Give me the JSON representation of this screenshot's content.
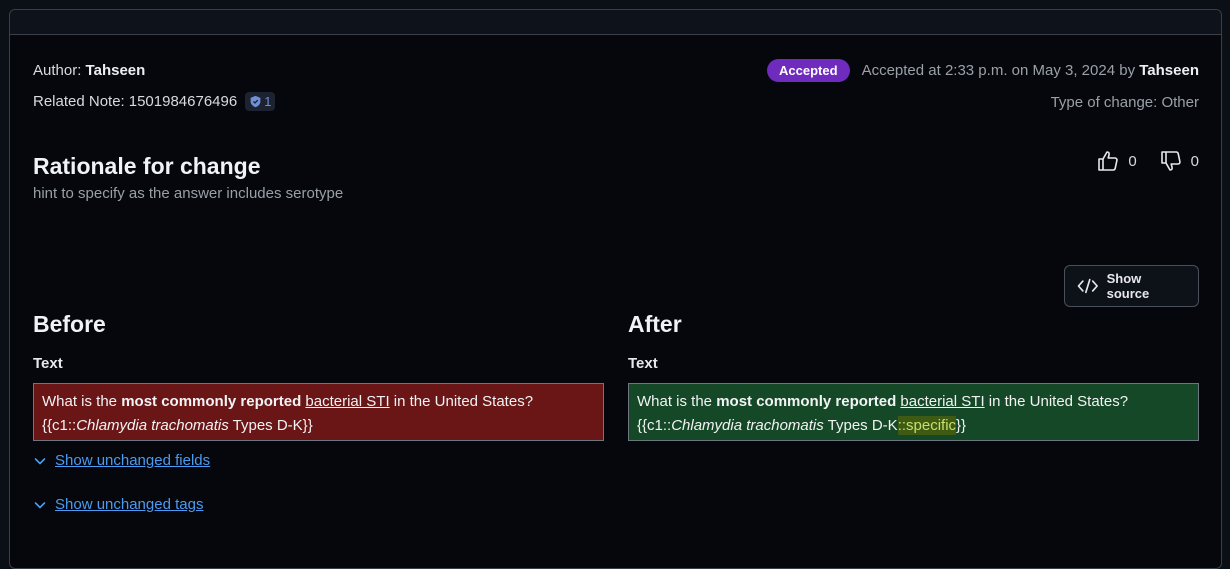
{
  "meta": {
    "author_label": "Author:",
    "author_name": "Tahseen",
    "related_note_label": "Related Note:",
    "related_note_id": "1501984676496",
    "related_note_badge": "1",
    "status": "Accepted",
    "accepted_text": "Accepted at 2:33 p.m. on May 3, 2024 by",
    "accepted_by": "Tahseen",
    "type_of_change": "Type of change: Other"
  },
  "rationale": {
    "title": "Rationale for change",
    "text": "hint to specify as the answer includes serotype"
  },
  "votes": {
    "up": "0",
    "down": "0"
  },
  "show_source_label": "Show source",
  "before": {
    "title": "Before",
    "field_label": "Text",
    "q_1": "What is the ",
    "q_bold": "most commonly reported",
    "q_2": " ",
    "q_under": "bacterial STI",
    "q_3": " in the United States?",
    "a_1": "{{c1::",
    "a_ital": "Chlamydia trachomatis",
    "a_2": " Types D-K}}"
  },
  "after": {
    "title": "After",
    "field_label": "Text",
    "q_1": "What is the ",
    "q_bold": "most commonly reported",
    "q_2": " ",
    "q_under": "bacterial STI",
    "q_3": " in the United States?",
    "a_1": "{{c1::",
    "a_ital": "Chlamydia trachomatis",
    "a_2": " Types D-K",
    "a_added": "::specific",
    "a_3": "}}"
  },
  "toggles": {
    "fields": "Show unchanged fields",
    "tags": "Show unchanged tags"
  },
  "colors": {
    "accepted_badge": "#6f2bbd",
    "before_bg": "#6a1616",
    "after_bg": "#154826",
    "link": "#4a9bf1"
  }
}
